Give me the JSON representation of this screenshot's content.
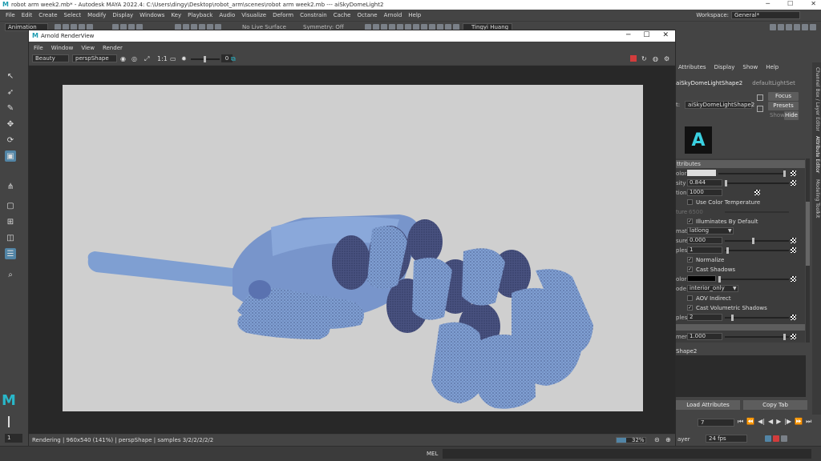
{
  "maya": {
    "title": "robot arm week2.mb* - Autodesk MAYA 2022.4: C:\\Users\\dingy\\Desktop\\robot_arm\\scenes\\robot arm week2.mb  ---  aiSkyDomeLight2",
    "menu": [
      "File",
      "Edit",
      "Create",
      "Select",
      "Modify",
      "Display",
      "Windows",
      "Key",
      "Playback",
      "Audio",
      "Visualize",
      "Deform",
      "Constrain",
      "Cache",
      "Octane",
      "Arnold",
      "Help"
    ],
    "workspace_label": "Workspace:",
    "workspace_value": "General*",
    "menuset": "Animation",
    "no_live_surface": "No Live Surface",
    "symmetry": "Symmetry: Off",
    "user": "Tingyi Huang"
  },
  "arnold": {
    "title": "Arnold RenderView",
    "menu": [
      "File",
      "Window",
      "View",
      "Render"
    ],
    "aov": "Beauty",
    "camera": "perspShape",
    "ratio": "1:1",
    "exposure": "0",
    "status": "Rendering | 960x540 (141%) | perspShape | samples 3/2/2/2/2/2",
    "zoom_label": "32%",
    "zoom_fraction": 0.32
  },
  "attr_editor": {
    "tabs": [
      "Attributes",
      "Display",
      "Show",
      "Help"
    ],
    "node_tab_active": "aiSkyDomeLightShape2",
    "node_tab_other": "defaultLightSet",
    "name_label": "t:",
    "name_value": "aiSkyDomeLightShape2",
    "focus_label": "Focus",
    "presets_label": "Presets",
    "show_label": "Show",
    "hide_label": "Hide",
    "section_title": "ttributes",
    "rows": {
      "color_label": "olor",
      "intensity_label": "sity",
      "intensity_value": "0.844",
      "resolution_label": "tion",
      "resolution_value": "1000",
      "use_color_temp": "Use Color Temperature",
      "temp_label": "ture",
      "temp_value": "6500",
      "illum_default": "Illuminates By Default",
      "format_label": "mat",
      "format_value": "latlong",
      "exposure_label": "sure",
      "exposure_value": "0.000",
      "samples_label": "ples",
      "samples_value": "1",
      "normalize": "Normalize",
      "cast_shadows": "Cast Shadows",
      "shadow_color_label": "olor",
      "mode_label": "ode",
      "mode_value": "interior_only",
      "aov_indirect": "AOV Indirect",
      "cast_vol_shadows": "Cast Volumetric Shadows",
      "vol_samples_label": "ples",
      "vol_samples_value": "2",
      "camera_label": "mera",
      "camera_value": "1.000"
    },
    "shape2_label": "Shape2",
    "load_attributes": "Load Attributes",
    "copy_tab": "Copy Tab",
    "vtabs": [
      "Channel Box / Layer Editor",
      "Attribute Editor",
      "Modeling Toolkit"
    ]
  },
  "timeline": {
    "current_frame": "7",
    "range_start": "1",
    "fps": "24 fps",
    "layer_label": "ayer"
  },
  "command": {
    "mel_label": "MEL"
  },
  "colors": {
    "ui_bg": "#444444",
    "field_bg": "#2b2b2b",
    "accent": "#5285a6",
    "render_bg": "#cfcfcf",
    "robot_light": "#7f9fd2",
    "robot_dark": "#48517f"
  }
}
